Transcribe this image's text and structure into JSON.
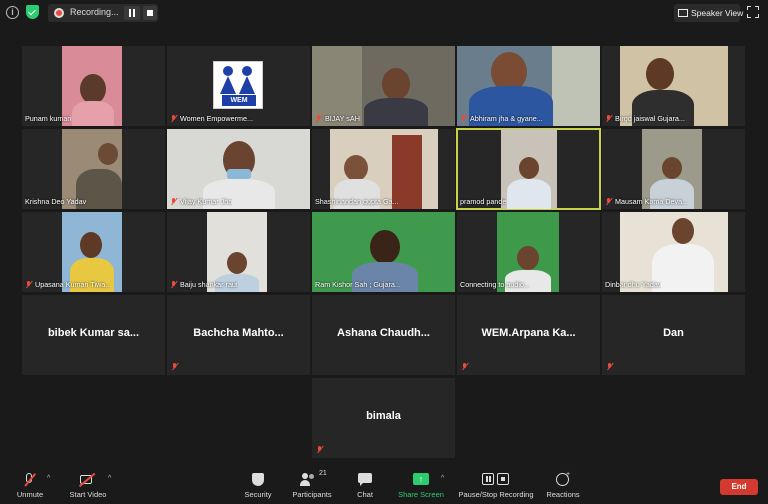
{
  "topbar": {
    "recording_label": "Recording...",
    "speaker_view_label": "Speaker View"
  },
  "participants": [
    {
      "name": "Punam kumari",
      "muted": false
    },
    {
      "name": "Women Empowerme...",
      "muted": true
    },
    {
      "name": "BIJAY sAH",
      "muted": true
    },
    {
      "name": "Abhiram jha & gyane...",
      "muted": true
    },
    {
      "name": "Birgd jaiswal Gujara...",
      "muted": true
    },
    {
      "name": "Krishna Deo Yadav",
      "muted": false
    },
    {
      "name": "Vijay Kumar Jha",
      "muted": true
    },
    {
      "name": "Shashinandan gupta Ga...",
      "muted": false
    },
    {
      "name": "pramod pande",
      "muted": false
    },
    {
      "name": "Mausam Kama Deva...",
      "muted": true
    },
    {
      "name": "Upasana Kumari Tiwa...",
      "muted": true
    },
    {
      "name": "Baiju shankar raut",
      "muted": true
    },
    {
      "name": "Ram Kishor Sah ; Gujara...",
      "muted": false
    },
    {
      "name": "Connecting to audio...",
      "muted": false
    },
    {
      "name": "Dinbandhu Yadav",
      "muted": false
    },
    {
      "name": "bibek Kumar sa...",
      "muted": false
    },
    {
      "name": "Bachcha Mahto...",
      "muted": true
    },
    {
      "name": "Ashana Chaudh...",
      "muted": false
    },
    {
      "name": "WEM.Arpana Ka...",
      "muted": true
    },
    {
      "name": "Dan",
      "muted": true
    },
    {
      "name": "bimala",
      "muted": true
    }
  ],
  "logo_text": "WEM",
  "toolbar": {
    "unmute": "Unmute",
    "start_video": "Start Video",
    "security": "Security",
    "participants": "Participants",
    "participants_count": "21",
    "chat": "Chat",
    "share_screen": "Share Screen",
    "pause_recording": "Pause/Stop Recording",
    "reactions": "Reactions",
    "end": "End"
  },
  "colors": {
    "background": "#1a1a1a",
    "tile": "#262626",
    "active_border": "#c7d34a",
    "share_green": "#2ecc71",
    "end_red": "#d23a2f",
    "muted_red": "#e74c3c"
  }
}
